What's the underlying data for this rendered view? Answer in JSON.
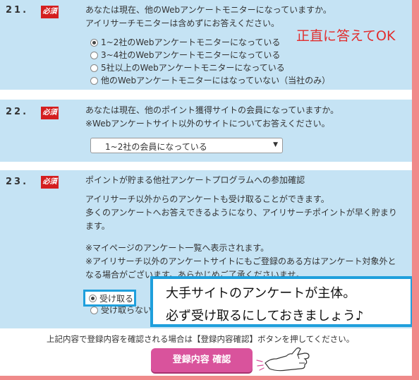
{
  "q21": {
    "num": "21.",
    "required": "必須",
    "lines": [
      "あなたは現在、他のWebアンケートモニターになっていますか。",
      "アイリサーチモニターは含めずにお答えください。"
    ],
    "options": [
      {
        "label": "1~2社のWebアンケートモニターになっている",
        "checked": true
      },
      {
        "label": "3~4社のWebアンケートモニターになっている",
        "checked": false
      },
      {
        "label": "5社以上のWebアンケートモニターになっている",
        "checked": false
      },
      {
        "label": "他のWebアンケートモニターにはなっていない（当社のみ）",
        "checked": false
      }
    ],
    "note": "正直に答えてOK"
  },
  "q22": {
    "num": "22.",
    "required": "必須",
    "lines": [
      "あなたは現在、他のポイント獲得サイトの会員になっていますか。",
      "※Webアンケートサイト以外のサイトについてお答えください。"
    ],
    "select_value": "1~2社の会員になっている",
    "arrow": "▼"
  },
  "q23": {
    "num": "23.",
    "required": "必須",
    "title": "ポイントが貯まる他社アンケートプログラムへの参加確認",
    "desc": [
      "アイリサーチ以外からのアンケートも受け取ることができます。",
      "多くのアンケートへお答えできるようになり、アイリサーチポイントが早く貯まり",
      "ます。"
    ],
    "notes": [
      "※マイページのアンケート一覧へ表示されます。",
      "※アイリサーチ以外のアンケートサイトにもご登録のある方はアンケート対象外と",
      "なる場合がございます。あらかじめご了承くださいませ。"
    ],
    "options": [
      {
        "label": "受け取る",
        "checked": true
      },
      {
        "label": "受け取らない",
        "checked": false
      }
    ]
  },
  "callout": {
    "line1": "大手サイトのアンケートが主体。",
    "line2": "必ず受け取るにしておきましょう♪"
  },
  "footer": {
    "instruction": "上記内容で登録内容を確認される場合は【登録内容確認】ボタンを押してください。",
    "button": "登録内容 確認"
  },
  "colors": {
    "section_bg": "#c5e3f4",
    "required_red": "#d41f1f",
    "note_red": "#e22d2d",
    "callout_blue": "#1f9fdc",
    "button_pink": "#d9539c",
    "frame_pink": "#f08a8a"
  }
}
